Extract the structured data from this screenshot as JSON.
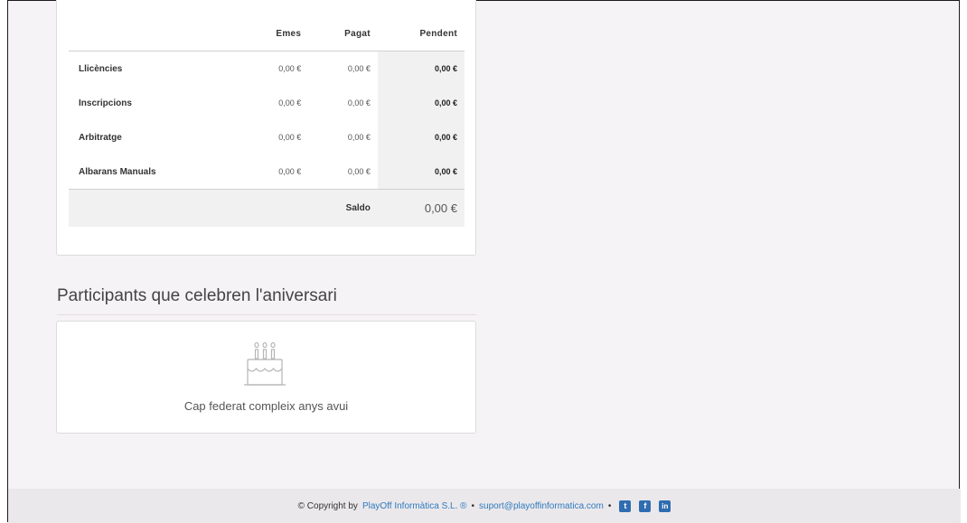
{
  "finance_table": {
    "headers": [
      "",
      "Emes",
      "Pagat",
      "Pendent"
    ],
    "rows": [
      {
        "label": "Llicències",
        "emes": "0,00 €",
        "pagat": "0,00 €",
        "pendent": "0,00 €"
      },
      {
        "label": "Inscripcions",
        "emes": "0,00 €",
        "pagat": "0,00 €",
        "pendent": "0,00 €"
      },
      {
        "label": "Arbitratge",
        "emes": "0,00 €",
        "pagat": "0,00 €",
        "pendent": "0,00 €"
      },
      {
        "label": "Albarans Manuals",
        "emes": "0,00 €",
        "pagat": "0,00 €",
        "pendent": "0,00 €"
      }
    ],
    "saldo_label": "Saldo",
    "saldo_value": "0,00 €"
  },
  "birthdays": {
    "title": "Participants que celebren l'aniversari",
    "empty_message": "Cap federat compleix anys avui",
    "icon": "birthday-cake-icon"
  },
  "footer": {
    "copyright_prefix": "© Copyright by",
    "company_link": "PlayOff Informàtica S.L. ®",
    "separator": "•",
    "email_link": "suport@playoffinformatica.com",
    "social": [
      "twitter-icon",
      "facebook-icon",
      "linkedin-icon"
    ],
    "twitter_glyph": "t",
    "facebook_glyph": "f",
    "linkedin_glyph": "in"
  }
}
